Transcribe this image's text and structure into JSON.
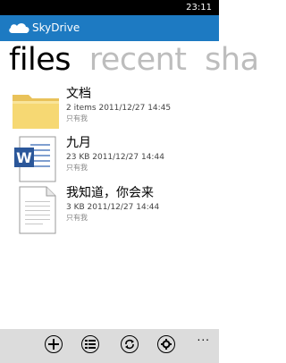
{
  "status": {
    "time": "23:11"
  },
  "app": {
    "title": "SkyDrive"
  },
  "pivot": [
    "files",
    "recent",
    "sha"
  ],
  "items": [
    {
      "name": "文档",
      "meta": "2 items  2011/12/27 14:45",
      "share": "只有我",
      "icon": "folder-icon"
    },
    {
      "name": "九月",
      "meta": "23 KB  2011/12/27 14:44",
      "share": "只有我",
      "icon": "word-document-icon"
    },
    {
      "name": "我知道，你会来",
      "meta": "3 KB  2011/12/27 14:44",
      "share": "只有我",
      "icon": "text-document-icon"
    }
  ],
  "appbar": {
    "icons": [
      "add-icon",
      "select-list-icon",
      "sync-icon",
      "settings-icon"
    ],
    "more": "..."
  },
  "colors": {
    "accent": "#1d7ac2",
    "folder": "#f6d873",
    "word": "#2b579a"
  }
}
